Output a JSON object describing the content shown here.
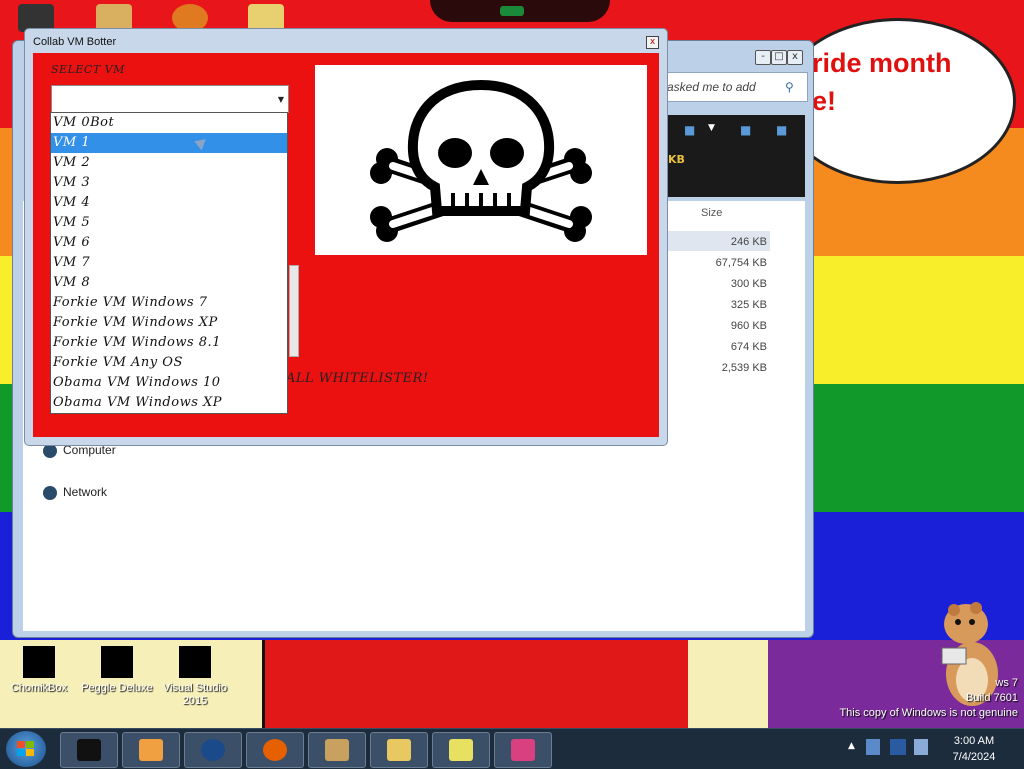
{
  "desktop": {
    "bubble_lines": [
      "ride month",
      "e!"
    ],
    "icons": [
      {
        "label": "ChomikBox"
      },
      {
        "label": "Peggle Deluxe"
      },
      {
        "label": "Visual Studio 2015"
      }
    ],
    "watermark_lines": [
      "ws 7",
      "Build 7601",
      "This copy of Windows is not genuine"
    ]
  },
  "explorer": {
    "search_placeholder": "asked me to add",
    "toolbar_fragment": "KB",
    "size_header": "Size",
    "sizes": [
      "246 KB",
      "67,754 KB",
      "300 KB",
      "325 KB",
      "960 KB",
      "674 KB",
      "2,539 KB"
    ],
    "nav": {
      "computer": "Computer",
      "network": "Network"
    },
    "controls": {
      "minimize": "-",
      "maximize": "□",
      "close": "x"
    }
  },
  "botter": {
    "title": "Collab VM Botter",
    "close_label": "x",
    "select_label": "SELECT VM",
    "combo_value": "",
    "whitelister_fragment": "ALL WHITELISTER!",
    "vm_options": [
      "VM 0Bot",
      "VM 1",
      "VM 2",
      "VM 3",
      "VM 4",
      "VM 5",
      "VM 6",
      "VM 7",
      "VM 8",
      "Forkie VM Windows 7",
      "Forkie VM Windows XP",
      "Forkie VM Windows 8.1",
      "Forkie VM Any OS",
      "Obama VM Windows 10",
      "Obama VM Windows XP"
    ],
    "selected_index": 1
  },
  "taskbar": {
    "time": "3:00 AM",
    "date": "7/4/2024"
  },
  "colors": {
    "rainbow": [
      "#e8151a",
      "#f58a1f",
      "#f8ef2a",
      "#119a2a",
      "#1a1fd8",
      "#7a2a9a"
    ],
    "botter_bg": "#ec1111",
    "selection": "#3390e8"
  }
}
